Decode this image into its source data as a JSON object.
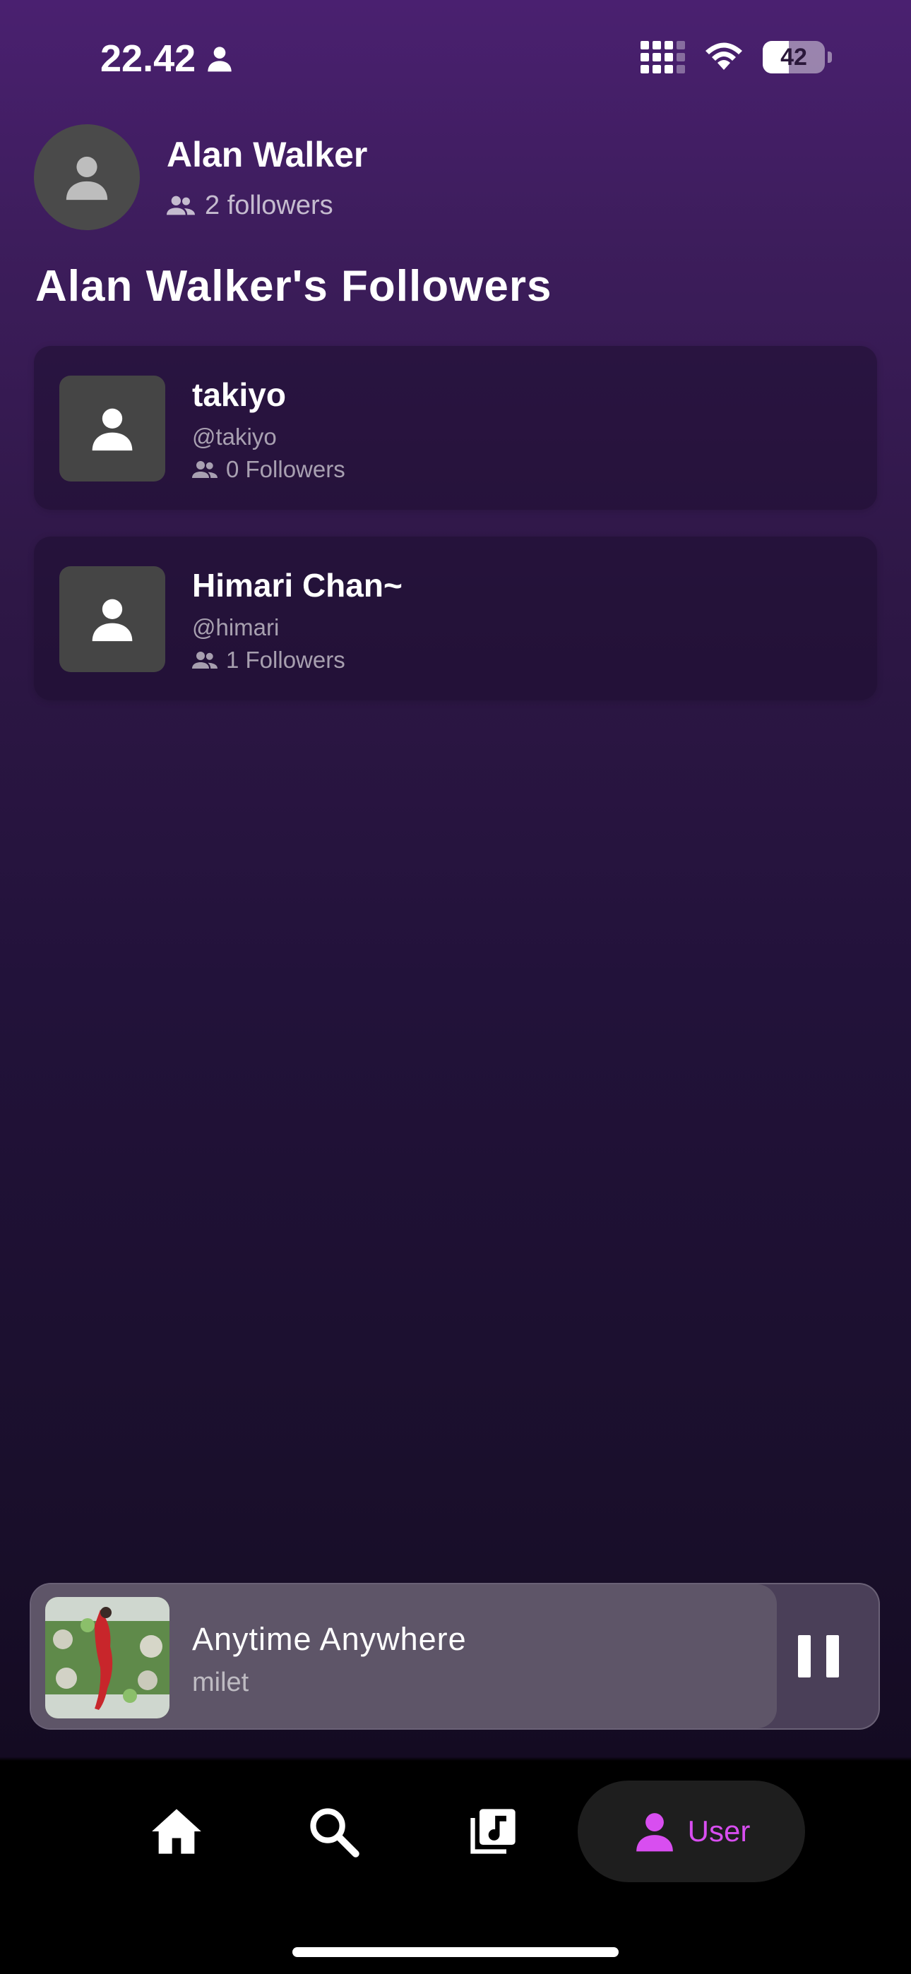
{
  "status_bar": {
    "time": "22.42",
    "battery": "42"
  },
  "profile": {
    "name": "Alan Walker",
    "followers": "2 followers"
  },
  "section_title": "Alan Walker's Followers",
  "followers": [
    {
      "name": "takiyo",
      "handle": "@takiyo",
      "followers": "0 Followers"
    },
    {
      "name": "Himari Chan~",
      "handle": "@himari",
      "followers": "1 Followers"
    }
  ],
  "now_playing": {
    "title": "Anytime Anywhere",
    "artist": "milet",
    "progress": 0.88
  },
  "nav": {
    "user_label": "User",
    "active": "user"
  },
  "colors": {
    "accent": "#d84ef0",
    "background_top": "#4a2070",
    "background_bottom": "#140b22"
  },
  "icons": {
    "status_person": "person-icon",
    "signal": "signal-icon",
    "wifi": "wifi-icon",
    "followers": "group-icon",
    "home": "home-icon",
    "search": "search-icon",
    "library": "music-library-icon",
    "user": "user-icon",
    "pause": "pause-icon"
  }
}
